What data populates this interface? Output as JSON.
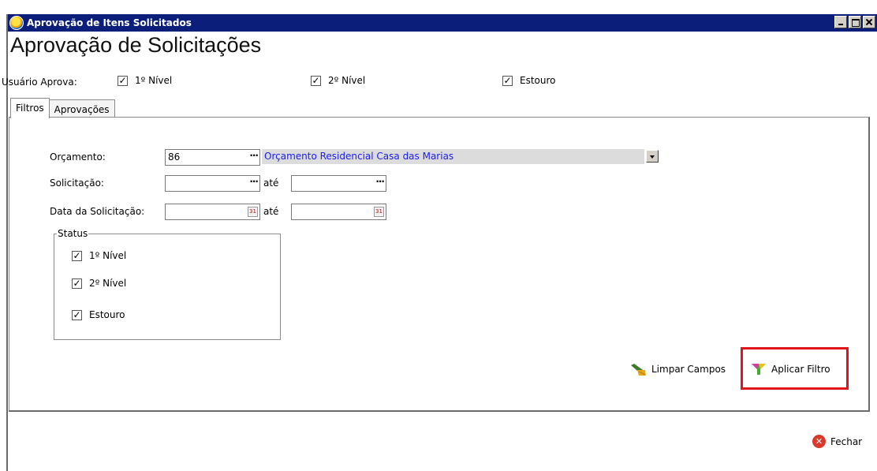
{
  "window": {
    "title": "Aprovação de Itens Solicitados"
  },
  "page_title": "Aprovação de Solicitações",
  "approver": {
    "label": "Usuário Aprova:",
    "checks": [
      {
        "label": "1º Nível",
        "checked": true
      },
      {
        "label": "2º Nível",
        "checked": true
      },
      {
        "label": "Estouro",
        "checked": true
      }
    ]
  },
  "tabs": [
    {
      "label": "Filtros",
      "active": true
    },
    {
      "label": "Aprovações",
      "active": false
    }
  ],
  "filters": {
    "orcamento": {
      "label": "Orçamento:",
      "value": "86",
      "description": "Orçamento Residencial Casa das Marias"
    },
    "solicitacao": {
      "label": "Solicitação:",
      "from": "",
      "to": "",
      "ate": "até"
    },
    "data": {
      "label": "Data da Solicitação:",
      "from": "",
      "to": "",
      "ate": "até"
    },
    "status": {
      "title": "Status",
      "items": [
        {
          "label": "1º Nível",
          "checked": true
        },
        {
          "label": "2º Nível",
          "checked": true
        },
        {
          "label": "Estouro",
          "checked": true
        }
      ]
    }
  },
  "actions": {
    "limpar": "Limpar Campos",
    "aplicar": "Aplicar Filtro",
    "fechar": "Fechar"
  },
  "colors": {
    "titlebar": "#0b1f7a",
    "highlight": "#e2141b",
    "description_text": "#1a1aff"
  }
}
